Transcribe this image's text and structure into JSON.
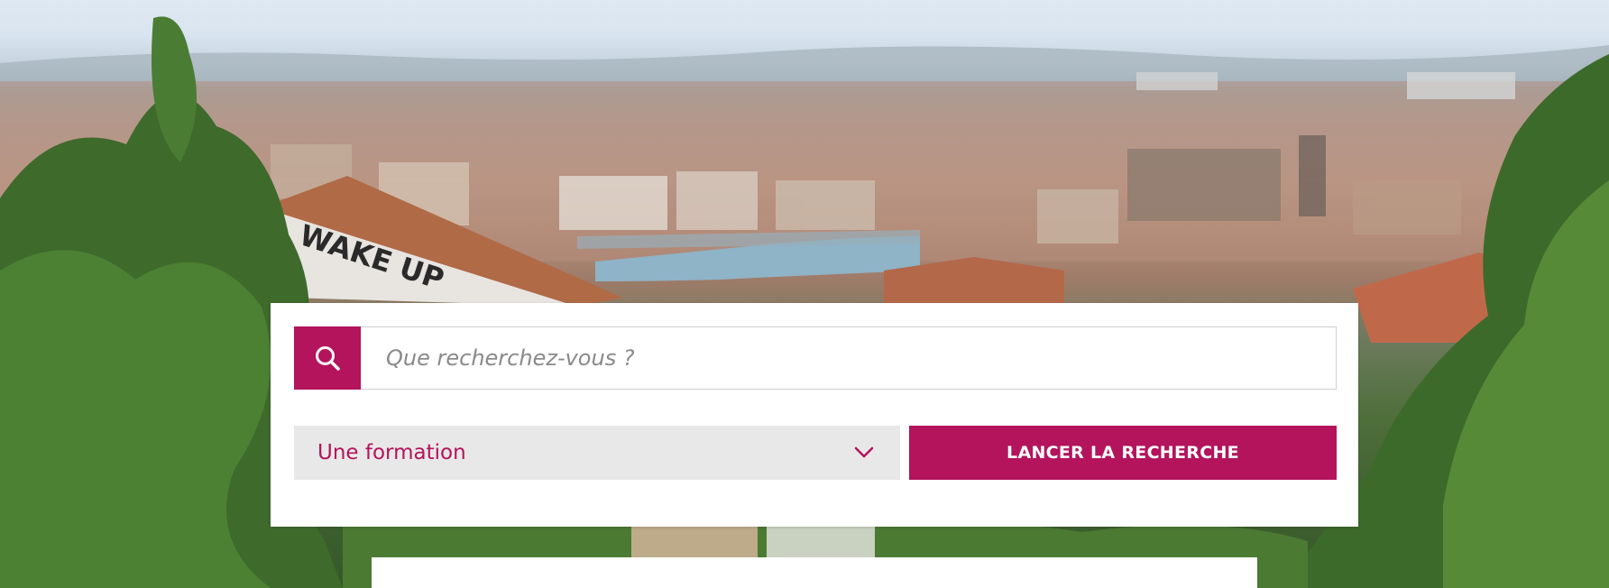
{
  "hero": {
    "background_icon": "city-panorama-image",
    "graffiti_text": "WAKE UP"
  },
  "search": {
    "icon": "search-icon",
    "placeholder": "Que recherchez-vous ?",
    "value": "",
    "select": {
      "selected": "Une formation",
      "icon": "chevron-down-icon"
    },
    "submit_label": "LANCER LA RECHERCHE"
  },
  "colors": {
    "accent": "#b3145c",
    "select_bg": "#e8e8e8",
    "card_bg": "#ffffff"
  }
}
